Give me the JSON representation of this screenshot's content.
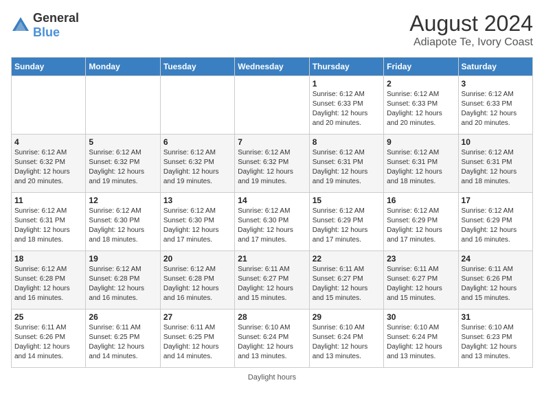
{
  "header": {
    "logo_general": "General",
    "logo_blue": "Blue",
    "main_title": "August 2024",
    "subtitle": "Adiapote Te, Ivory Coast"
  },
  "calendar": {
    "days_of_week": [
      "Sunday",
      "Monday",
      "Tuesday",
      "Wednesday",
      "Thursday",
      "Friday",
      "Saturday"
    ],
    "weeks": [
      [
        {
          "day": "",
          "info": ""
        },
        {
          "day": "",
          "info": ""
        },
        {
          "day": "",
          "info": ""
        },
        {
          "day": "",
          "info": ""
        },
        {
          "day": "1",
          "info": "Sunrise: 6:12 AM\nSunset: 6:33 PM\nDaylight: 12 hours\nand 20 minutes."
        },
        {
          "day": "2",
          "info": "Sunrise: 6:12 AM\nSunset: 6:33 PM\nDaylight: 12 hours\nand 20 minutes."
        },
        {
          "day": "3",
          "info": "Sunrise: 6:12 AM\nSunset: 6:33 PM\nDaylight: 12 hours\nand 20 minutes."
        }
      ],
      [
        {
          "day": "4",
          "info": "Sunrise: 6:12 AM\nSunset: 6:32 PM\nDaylight: 12 hours\nand 20 minutes."
        },
        {
          "day": "5",
          "info": "Sunrise: 6:12 AM\nSunset: 6:32 PM\nDaylight: 12 hours\nand 19 minutes."
        },
        {
          "day": "6",
          "info": "Sunrise: 6:12 AM\nSunset: 6:32 PM\nDaylight: 12 hours\nand 19 minutes."
        },
        {
          "day": "7",
          "info": "Sunrise: 6:12 AM\nSunset: 6:32 PM\nDaylight: 12 hours\nand 19 minutes."
        },
        {
          "day": "8",
          "info": "Sunrise: 6:12 AM\nSunset: 6:31 PM\nDaylight: 12 hours\nand 19 minutes."
        },
        {
          "day": "9",
          "info": "Sunrise: 6:12 AM\nSunset: 6:31 PM\nDaylight: 12 hours\nand 18 minutes."
        },
        {
          "day": "10",
          "info": "Sunrise: 6:12 AM\nSunset: 6:31 PM\nDaylight: 12 hours\nand 18 minutes."
        }
      ],
      [
        {
          "day": "11",
          "info": "Sunrise: 6:12 AM\nSunset: 6:31 PM\nDaylight: 12 hours\nand 18 minutes."
        },
        {
          "day": "12",
          "info": "Sunrise: 6:12 AM\nSunset: 6:30 PM\nDaylight: 12 hours\nand 18 minutes."
        },
        {
          "day": "13",
          "info": "Sunrise: 6:12 AM\nSunset: 6:30 PM\nDaylight: 12 hours\nand 17 minutes."
        },
        {
          "day": "14",
          "info": "Sunrise: 6:12 AM\nSunset: 6:30 PM\nDaylight: 12 hours\nand 17 minutes."
        },
        {
          "day": "15",
          "info": "Sunrise: 6:12 AM\nSunset: 6:29 PM\nDaylight: 12 hours\nand 17 minutes."
        },
        {
          "day": "16",
          "info": "Sunrise: 6:12 AM\nSunset: 6:29 PM\nDaylight: 12 hours\nand 17 minutes."
        },
        {
          "day": "17",
          "info": "Sunrise: 6:12 AM\nSunset: 6:29 PM\nDaylight: 12 hours\nand 16 minutes."
        }
      ],
      [
        {
          "day": "18",
          "info": "Sunrise: 6:12 AM\nSunset: 6:28 PM\nDaylight: 12 hours\nand 16 minutes."
        },
        {
          "day": "19",
          "info": "Sunrise: 6:12 AM\nSunset: 6:28 PM\nDaylight: 12 hours\nand 16 minutes."
        },
        {
          "day": "20",
          "info": "Sunrise: 6:12 AM\nSunset: 6:28 PM\nDaylight: 12 hours\nand 16 minutes."
        },
        {
          "day": "21",
          "info": "Sunrise: 6:11 AM\nSunset: 6:27 PM\nDaylight: 12 hours\nand 15 minutes."
        },
        {
          "day": "22",
          "info": "Sunrise: 6:11 AM\nSunset: 6:27 PM\nDaylight: 12 hours\nand 15 minutes."
        },
        {
          "day": "23",
          "info": "Sunrise: 6:11 AM\nSunset: 6:27 PM\nDaylight: 12 hours\nand 15 minutes."
        },
        {
          "day": "24",
          "info": "Sunrise: 6:11 AM\nSunset: 6:26 PM\nDaylight: 12 hours\nand 15 minutes."
        }
      ],
      [
        {
          "day": "25",
          "info": "Sunrise: 6:11 AM\nSunset: 6:26 PM\nDaylight: 12 hours\nand 14 minutes."
        },
        {
          "day": "26",
          "info": "Sunrise: 6:11 AM\nSunset: 6:25 PM\nDaylight: 12 hours\nand 14 minutes."
        },
        {
          "day": "27",
          "info": "Sunrise: 6:11 AM\nSunset: 6:25 PM\nDaylight: 12 hours\nand 14 minutes."
        },
        {
          "day": "28",
          "info": "Sunrise: 6:10 AM\nSunset: 6:24 PM\nDaylight: 12 hours\nand 13 minutes."
        },
        {
          "day": "29",
          "info": "Sunrise: 6:10 AM\nSunset: 6:24 PM\nDaylight: 12 hours\nand 13 minutes."
        },
        {
          "day": "30",
          "info": "Sunrise: 6:10 AM\nSunset: 6:24 PM\nDaylight: 12 hours\nand 13 minutes."
        },
        {
          "day": "31",
          "info": "Sunrise: 6:10 AM\nSunset: 6:23 PM\nDaylight: 12 hours\nand 13 minutes."
        }
      ]
    ]
  },
  "footer": {
    "note": "Daylight hours"
  }
}
